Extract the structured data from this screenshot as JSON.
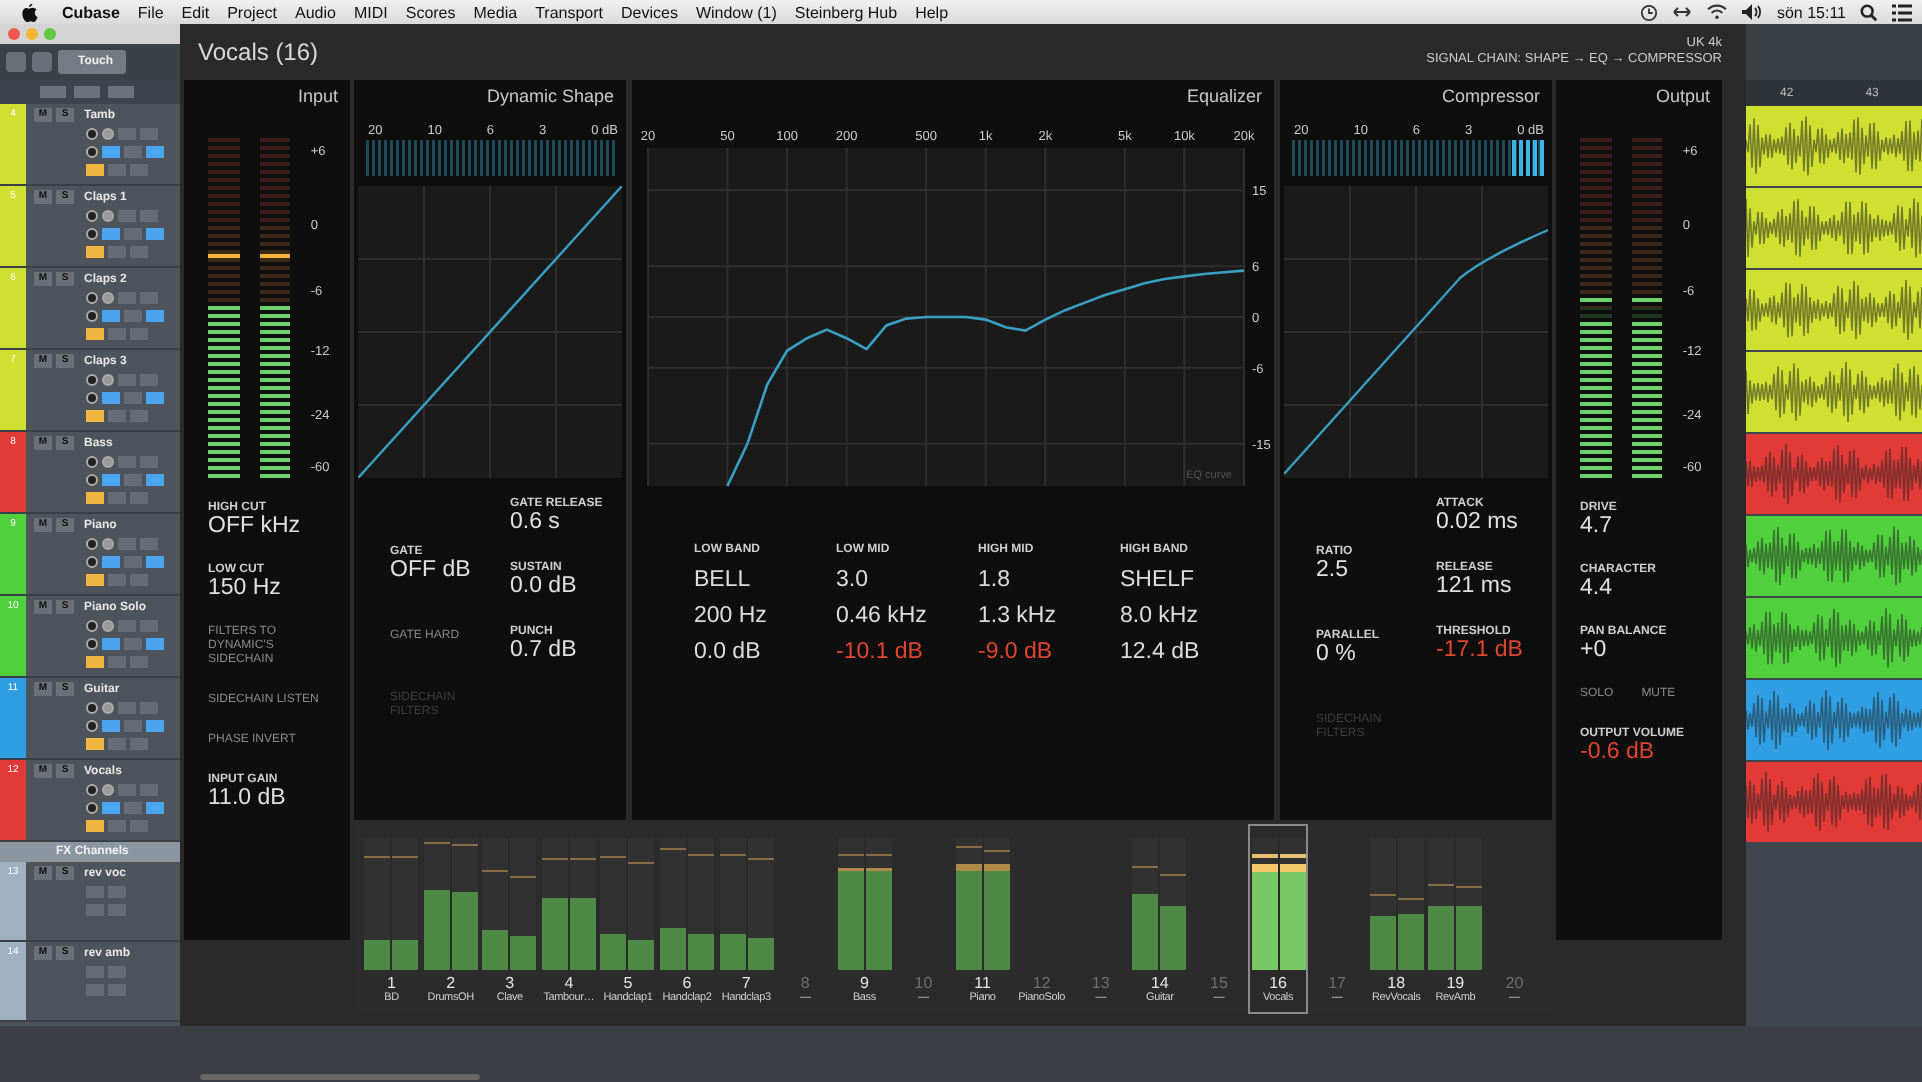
{
  "menu_bar": {
    "app": "Cubase",
    "items": [
      "File",
      "Edit",
      "Project",
      "Audio",
      "MIDI",
      "Scores",
      "Media",
      "Transport",
      "Devices",
      "Window (1)",
      "Steinberg Hub",
      "Help"
    ],
    "clock": "sön 15:11"
  },
  "project": {
    "touch_button": "Touch",
    "tracks": [
      {
        "number": "4",
        "name": "Tamb",
        "color": "#cfe030",
        "buttons": [
          "M",
          "S"
        ]
      },
      {
        "number": "5",
        "name": "Claps 1",
        "color": "#cfe030",
        "buttons": [
          "M",
          "S"
        ]
      },
      {
        "number": "6",
        "name": "Claps 2",
        "color": "#cfe030",
        "buttons": [
          "M",
          "S"
        ]
      },
      {
        "number": "7",
        "name": "Claps 3",
        "color": "#cfe030",
        "buttons": [
          "M",
          "S"
        ]
      },
      {
        "number": "8",
        "name": "Bass",
        "color": "#e23a36",
        "buttons": [
          "M",
          "S"
        ]
      },
      {
        "number": "9",
        "name": "Piano",
        "color": "#4fd03c",
        "buttons": [
          "M",
          "S"
        ]
      },
      {
        "number": "10",
        "name": "Piano Solo",
        "color": "#4fd03c",
        "buttons": [
          "M",
          "S"
        ]
      },
      {
        "number": "11",
        "name": "Guitar",
        "color": "#2f9ee2",
        "buttons": [
          "M",
          "S"
        ]
      },
      {
        "number": "12",
        "name": "Vocals",
        "color": "#e23a36",
        "buttons": [
          "M",
          "S"
        ]
      }
    ],
    "folder": {
      "name": "FX Channels"
    },
    "fx_tracks": [
      {
        "number": "13",
        "name": "rev voc",
        "buttons": [
          "M",
          "S"
        ]
      },
      {
        "number": "14",
        "name": "rev amb",
        "buttons": [
          "M",
          "S"
        ]
      }
    ],
    "ruler": [
      "42",
      "43"
    ]
  },
  "plugin": {
    "title": "Vocals (16)",
    "preset": "UK 4k",
    "signal_chain": "SIGNAL CHAIN: SHAPE → EQ → COMPRESSOR",
    "input": {
      "title": "Input",
      "meter": {
        "scale": [
          "+6",
          "0",
          "-6",
          "-12",
          "-24",
          "-60"
        ],
        "channels": [
          {
            "level": 0.52,
            "peak": {
              "level": 0.65
            }
          },
          {
            "level": 0.52,
            "peak": {
              "level": 0.65
            }
          }
        ]
      },
      "controls": [
        {
          "kind": "param",
          "label": "HIGH CUT",
          "value": "OFF kHz",
          "alert": false
        },
        {
          "kind": "param",
          "label": "LOW CUT",
          "value": "150 Hz",
          "alert": false
        },
        {
          "kind": "switch",
          "label": "FILTERS TO DYNAMIC'S SIDECHAIN",
          "on": false,
          "disabled": false
        },
        {
          "kind": "switch",
          "label": "SIDECHAIN LISTEN",
          "on": false,
          "disabled": false
        },
        {
          "kind": "switch",
          "label": "PHASE INVERT",
          "on": false,
          "disabled": false
        },
        {
          "kind": "param",
          "label": "INPUT GAIN",
          "value": "11.0 dB",
          "alert": false
        }
      ]
    },
    "dynamic_shape": {
      "title": "Dynamic Shape",
      "reduction_meter": {
        "scale": [
          "20",
          "10",
          "6",
          "3",
          "0 dB"
        ],
        "level": 0
      },
      "left": [
        {
          "kind": "param",
          "label": "GATE",
          "value": "OFF dB",
          "alert": false
        },
        {
          "kind": "switch",
          "label": "GATE HARD",
          "on": false,
          "disabled": false
        },
        {
          "kind": "switch",
          "label": "SIDECHAIN FILTERS",
          "on": false,
          "disabled": true
        }
      ],
      "right": [
        {
          "kind": "param",
          "label": "GATE RELEASE",
          "value": "0.6 s",
          "alert": false
        },
        {
          "kind": "param",
          "label": "SUSTAIN",
          "value": "0.0 dB",
          "alert": false
        },
        {
          "kind": "param",
          "label": "PUNCH",
          "value": "0.7 dB",
          "alert": false
        }
      ]
    },
    "equalizer": {
      "title": "Equalizer",
      "chart_data": {
        "type": "line",
        "categories": [
          "20",
          null,
          null,
          null,
          "50",
          null,
          null,
          "100",
          null,
          null,
          "200",
          null,
          null,
          null,
          "500",
          null,
          null,
          "1k",
          null,
          null,
          "2k",
          null,
          null,
          null,
          "5k",
          null,
          null,
          "10k",
          null,
          null,
          "20k"
        ],
        "series": [
          {
            "name": "EQ curve",
            "color": "#3a9fc0",
            "values": [
              null,
              null,
              null,
              null,
              -20,
              -15,
              -8,
              -4,
              -2.5,
              -1.5,
              -2.5,
              -3.8,
              -1,
              -0.2,
              0,
              0,
              0,
              -0.3,
              -1.2,
              -1.6,
              -0.3,
              0.8,
              1.7,
              2.6,
              3.3,
              4,
              4.5,
              4.8,
              5.1,
              5.3,
              5.5
            ]
          }
        ],
        "ylim": [
          -20,
          20
        ],
        "grid": true,
        "yticks": [
          15,
          6,
          0,
          -6,
          -15
        ]
      },
      "bands": [
        {
          "label": "LOW BAND",
          "shape": "BELL",
          "frequency": "200 Hz",
          "gain": "0.0 dB",
          "alert": false
        },
        {
          "label": "LOW MID",
          "shape": "3.0",
          "frequency": "0.46 kHz",
          "gain": "-10.1 dB",
          "alert": true
        },
        {
          "label": "HIGH MID",
          "shape": "1.8",
          "frequency": "1.3 kHz",
          "gain": "-9.0 dB",
          "alert": true
        },
        {
          "label": "HIGH BAND",
          "shape": "SHELF",
          "frequency": "8.0 kHz",
          "gain": "12.4 dB",
          "alert": false
        }
      ]
    },
    "compressor": {
      "title": "Compressor",
      "reduction_meter": {
        "scale": [
          "20",
          "10",
          "6",
          "3",
          "0 dB"
        ],
        "level": 0.13
      },
      "left": [
        {
          "kind": "param",
          "label": "RATIO",
          "value": "2.5",
          "alert": false
        },
        {
          "kind": "param",
          "label": "PARALLEL",
          "value": "0 %",
          "alert": false
        },
        {
          "kind": "switch",
          "label": "SIDECHAIN FILTERS",
          "on": false,
          "disabled": true
        }
      ],
      "right": [
        {
          "kind": "param",
          "label": "ATTACK",
          "value": "0.02 ms",
          "alert": false
        },
        {
          "kind": "param",
          "label": "RELEASE",
          "value": "121 ms",
          "alert": false
        },
        {
          "kind": "param",
          "label": "THRESHOLD",
          "value": "-17.1 dB",
          "alert": true
        }
      ]
    },
    "output": {
      "title": "Output",
      "meter": {
        "scale": [
          "+6",
          "0",
          "-6",
          "-12",
          "-24",
          "-60"
        ],
        "channels": [
          {
            "level": 0.46,
            "peak": {
              "level": 0.52
            }
          },
          {
            "level": 0.46,
            "peak": {
              "level": 0.52
            }
          }
        ]
      },
      "controls": [
        {
          "kind": "param",
          "label": "DRIVE",
          "value": "4.7",
          "alert": false
        },
        {
          "kind": "param",
          "label": "CHARACTER",
          "value": "4.4",
          "alert": false
        },
        {
          "kind": "param",
          "label": "PAN BALANCE",
          "value": "+0",
          "alert": false
        },
        {
          "kind": "switch_row",
          "switches": [
            {
              "label": "SOLO",
              "on": false,
              "disabled": false
            },
            {
              "label": "MUTE",
              "on": false,
              "disabled": false
            }
          ]
        },
        {
          "kind": "param",
          "label": "OUTPUT VOLUME",
          "value": "-0.6 dB",
          "alert": true
        }
      ]
    },
    "mixer": [
      {
        "number": "1",
        "name": "BD",
        "selected": false,
        "bars": [
          {
            "level": 0.23,
            "peak": {
              "level": 0.85
            }
          },
          {
            "level": 0.23,
            "peak": {
              "level": 0.85
            }
          }
        ]
      },
      {
        "number": "2",
        "name": "DrumsOH",
        "selected": false,
        "bars": [
          {
            "level": 0.6,
            "peak": {
              "level": 0.96
            }
          },
          {
            "level": 0.59,
            "peak": {
              "level": 0.94
            }
          }
        ]
      },
      {
        "number": "3",
        "name": "Clave",
        "selected": false,
        "bars": [
          {
            "level": 0.3,
            "peak": {
              "level": 0.75
            }
          },
          {
            "level": 0.26,
            "peak": {
              "level": 0.7
            }
          }
        ]
      },
      {
        "number": "4",
        "name": "Tambour…",
        "selected": false,
        "bars": [
          {
            "level": 0.55,
            "peak": {
              "level": 0.83
            }
          },
          {
            "level": 0.55,
            "peak": {
              "level": 0.83
            }
          }
        ]
      },
      {
        "number": "5",
        "name": "Handclap1",
        "selected": false,
        "bars": [
          {
            "level": 0.27,
            "peak": {
              "level": 0.85
            }
          },
          {
            "level": 0.23,
            "peak": {
              "level": 0.81
            }
          }
        ]
      },
      {
        "number": "6",
        "name": "Handclap2",
        "selected": false,
        "bars": [
          {
            "level": 0.32,
            "peak": {
              "level": 0.91
            }
          },
          {
            "level": 0.28,
            "peak": {
              "level": 0.87
            }
          }
        ]
      },
      {
        "number": "7",
        "name": "Handclap3",
        "selected": false,
        "bars": [
          {
            "level": 0.28,
            "peak": {
              "level": 0.87
            }
          },
          {
            "level": 0.24,
            "peak": {
              "level": 0.83
            }
          }
        ]
      },
      {
        "number": "8",
        "name": "—",
        "selected": false
      },
      {
        "number": "9",
        "name": "Bass",
        "selected": false,
        "bars": [
          {
            "level": 0.77,
            "peak": {
              "level": 0.87
            }
          },
          {
            "level": 0.77,
            "peak": {
              "level": 0.87
            }
          }
        ]
      },
      {
        "number": "10",
        "name": "—",
        "selected": false
      },
      {
        "number": "11",
        "name": "Piano",
        "selected": false,
        "bars": [
          {
            "level": 0.8,
            "peak": {
              "level": 0.92
            }
          },
          {
            "level": 0.8,
            "peak": {
              "level": 0.9
            }
          }
        ]
      },
      {
        "number": "12",
        "name": "PianoSolo",
        "selected": false
      },
      {
        "number": "13",
        "name": "—",
        "selected": false
      },
      {
        "number": "14",
        "name": "Guitar",
        "selected": false,
        "bars": [
          {
            "level": 0.57,
            "peak": {
              "level": 0.78
            }
          },
          {
            "level": 0.48,
            "peak": {
              "level": 0.71
            }
          }
        ]
      },
      {
        "number": "15",
        "name": "—",
        "selected": false
      },
      {
        "number": "16",
        "name": "Vocals",
        "selected": true,
        "bars": [
          {
            "level": 0.81,
            "peak": {
              "level": 0.85
            }
          },
          {
            "level": 0.81,
            "peak": {
              "level": 0.85
            }
          }
        ]
      },
      {
        "number": "17",
        "name": "—",
        "selected": false
      },
      {
        "number": "18",
        "name": "RevVocals",
        "selected": false,
        "bars": [
          {
            "level": 0.41,
            "peak": {
              "level": 0.56
            }
          },
          {
            "level": 0.42,
            "peak": {
              "level": 0.53
            }
          }
        ]
      },
      {
        "number": "19",
        "name": "RevAmb",
        "selected": false,
        "bars": [
          {
            "level": 0.49,
            "peak": {
              "level": 0.63
            }
          },
          {
            "level": 0.49,
            "peak": {
              "level": 0.62
            }
          }
        ]
      },
      {
        "number": "20",
        "name": "—",
        "selected": false
      }
    ]
  }
}
